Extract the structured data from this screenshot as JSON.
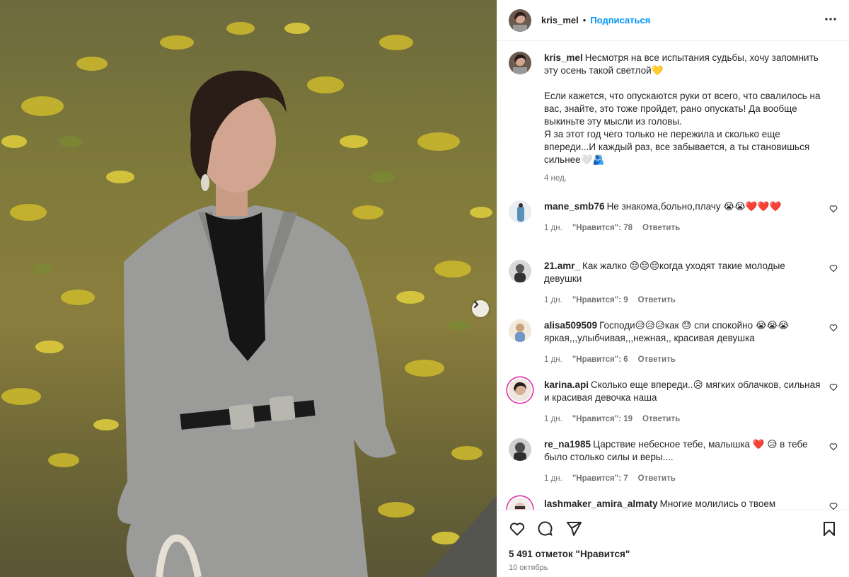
{
  "post": {
    "author": "kris_mel",
    "separator": "•",
    "follow_label": "Подписаться",
    "caption_user": "kris_mel",
    "caption_text": "Несмотря на все испытания судьбы, хочу запомнить эту осень такой светлой💛\n\nЕсли кажется, что опускаются руки от всего, что свалилось на вас, знайте, это тоже пройдет, рано опускать! Да вообще выкиньте эту мысли из головы.\nЯ за этот год чего только не пережила и сколько еще впереди...И каждый раз, все забывается, а ты становишься сильнее🤍🫂",
    "caption_time": "4 нед.",
    "likes": "5 491 отметок \"Нравится\"",
    "date": "10 октябрь"
  },
  "comments": [
    {
      "user": "mane_smb76",
      "text": "Не знакома,больно,плачу 😭😭❤️❤️❤️",
      "time": "1 дн.",
      "likes": "\"Нравится\": 78",
      "reply": "Ответить"
    },
    {
      "user": "21.amr_",
      "text": "Как жалко 😔😔😔когда уходят такие молодые девушки",
      "time": "1 дн.",
      "likes": "\"Нравится\": 9",
      "reply": "Ответить"
    },
    {
      "user": "alisa509509",
      "text": "Господи😥😥😥как 😓 спи спокойно 😭😭😭 яркая,,,улыбчивая,,,нежная,, красивая девушка",
      "time": "1 дн.",
      "likes": "\"Нравится\": 6",
      "reply": "Ответить"
    },
    {
      "user": "karina.api",
      "text": "Сколько еще впереди..😥 мягких облачков, сильная и красивая девочка наша",
      "time": "1 дн.",
      "likes": "\"Нравится\": 19",
      "reply": "Ответить"
    },
    {
      "user": "re_na1985",
      "text": "Царствие небесное тебе, малышка ❤️ 😥 в тебе было столько силы и веры....",
      "time": "1 дн.",
      "likes": "\"Нравится\": 7",
      "reply": "Ответить"
    },
    {
      "user": "lashmaker_amira_almaty",
      "text": "Многие молились о твоем восстановлении,многие восхищались твоей красотой и силой",
      "time": "",
      "likes": "",
      "reply": ""
    }
  ],
  "icons": {
    "more": "more-options-icon",
    "like": "heart-icon",
    "comment": "comment-icon",
    "share": "share-icon",
    "save": "bookmark-icon",
    "next": "chevron-right-icon"
  },
  "colors": {
    "link": "#0095f6",
    "text": "#262626",
    "muted": "#737373",
    "border": "#efefef"
  }
}
